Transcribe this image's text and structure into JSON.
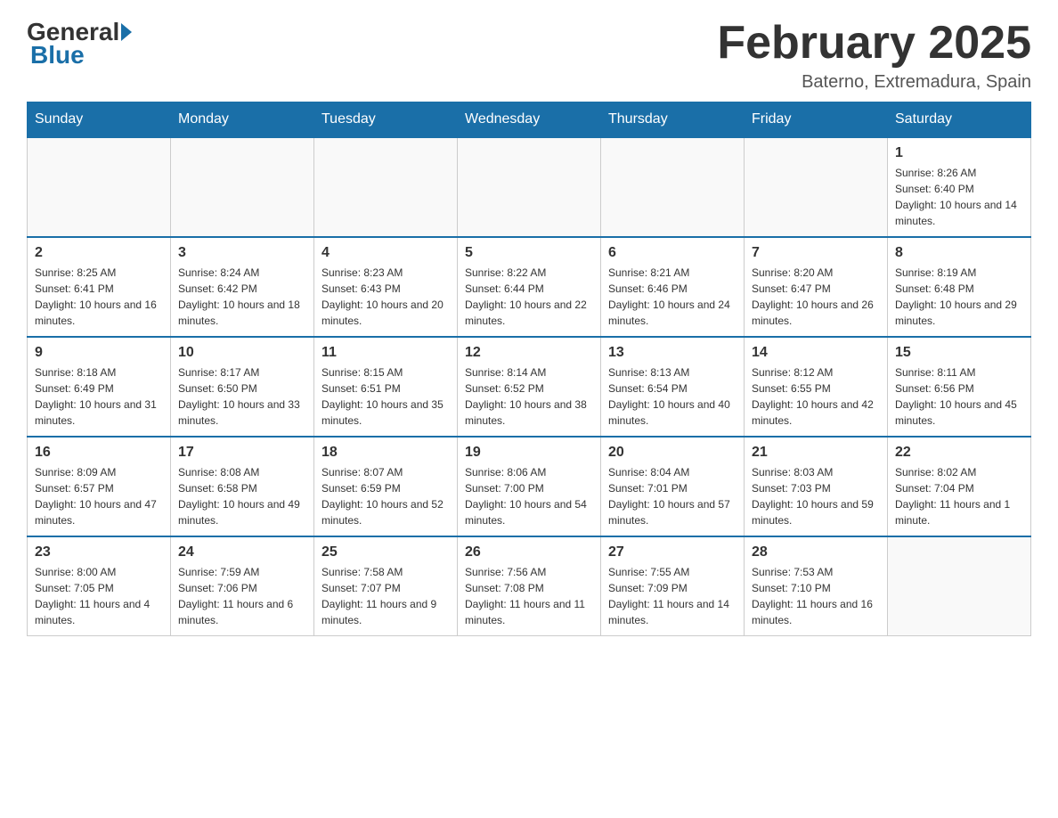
{
  "header": {
    "logo_general": "General",
    "logo_blue": "Blue",
    "month_title": "February 2025",
    "location": "Baterno, Extremadura, Spain"
  },
  "days_of_week": [
    "Sunday",
    "Monday",
    "Tuesday",
    "Wednesday",
    "Thursday",
    "Friday",
    "Saturday"
  ],
  "weeks": [
    {
      "days": [
        {
          "num": "",
          "info": ""
        },
        {
          "num": "",
          "info": ""
        },
        {
          "num": "",
          "info": ""
        },
        {
          "num": "",
          "info": ""
        },
        {
          "num": "",
          "info": ""
        },
        {
          "num": "",
          "info": ""
        },
        {
          "num": "1",
          "info": "Sunrise: 8:26 AM\nSunset: 6:40 PM\nDaylight: 10 hours and 14 minutes."
        }
      ]
    },
    {
      "days": [
        {
          "num": "2",
          "info": "Sunrise: 8:25 AM\nSunset: 6:41 PM\nDaylight: 10 hours and 16 minutes."
        },
        {
          "num": "3",
          "info": "Sunrise: 8:24 AM\nSunset: 6:42 PM\nDaylight: 10 hours and 18 minutes."
        },
        {
          "num": "4",
          "info": "Sunrise: 8:23 AM\nSunset: 6:43 PM\nDaylight: 10 hours and 20 minutes."
        },
        {
          "num": "5",
          "info": "Sunrise: 8:22 AM\nSunset: 6:44 PM\nDaylight: 10 hours and 22 minutes."
        },
        {
          "num": "6",
          "info": "Sunrise: 8:21 AM\nSunset: 6:46 PM\nDaylight: 10 hours and 24 minutes."
        },
        {
          "num": "7",
          "info": "Sunrise: 8:20 AM\nSunset: 6:47 PM\nDaylight: 10 hours and 26 minutes."
        },
        {
          "num": "8",
          "info": "Sunrise: 8:19 AM\nSunset: 6:48 PM\nDaylight: 10 hours and 29 minutes."
        }
      ]
    },
    {
      "days": [
        {
          "num": "9",
          "info": "Sunrise: 8:18 AM\nSunset: 6:49 PM\nDaylight: 10 hours and 31 minutes."
        },
        {
          "num": "10",
          "info": "Sunrise: 8:17 AM\nSunset: 6:50 PM\nDaylight: 10 hours and 33 minutes."
        },
        {
          "num": "11",
          "info": "Sunrise: 8:15 AM\nSunset: 6:51 PM\nDaylight: 10 hours and 35 minutes."
        },
        {
          "num": "12",
          "info": "Sunrise: 8:14 AM\nSunset: 6:52 PM\nDaylight: 10 hours and 38 minutes."
        },
        {
          "num": "13",
          "info": "Sunrise: 8:13 AM\nSunset: 6:54 PM\nDaylight: 10 hours and 40 minutes."
        },
        {
          "num": "14",
          "info": "Sunrise: 8:12 AM\nSunset: 6:55 PM\nDaylight: 10 hours and 42 minutes."
        },
        {
          "num": "15",
          "info": "Sunrise: 8:11 AM\nSunset: 6:56 PM\nDaylight: 10 hours and 45 minutes."
        }
      ]
    },
    {
      "days": [
        {
          "num": "16",
          "info": "Sunrise: 8:09 AM\nSunset: 6:57 PM\nDaylight: 10 hours and 47 minutes."
        },
        {
          "num": "17",
          "info": "Sunrise: 8:08 AM\nSunset: 6:58 PM\nDaylight: 10 hours and 49 minutes."
        },
        {
          "num": "18",
          "info": "Sunrise: 8:07 AM\nSunset: 6:59 PM\nDaylight: 10 hours and 52 minutes."
        },
        {
          "num": "19",
          "info": "Sunrise: 8:06 AM\nSunset: 7:00 PM\nDaylight: 10 hours and 54 minutes."
        },
        {
          "num": "20",
          "info": "Sunrise: 8:04 AM\nSunset: 7:01 PM\nDaylight: 10 hours and 57 minutes."
        },
        {
          "num": "21",
          "info": "Sunrise: 8:03 AM\nSunset: 7:03 PM\nDaylight: 10 hours and 59 minutes."
        },
        {
          "num": "22",
          "info": "Sunrise: 8:02 AM\nSunset: 7:04 PM\nDaylight: 11 hours and 1 minute."
        }
      ]
    },
    {
      "days": [
        {
          "num": "23",
          "info": "Sunrise: 8:00 AM\nSunset: 7:05 PM\nDaylight: 11 hours and 4 minutes."
        },
        {
          "num": "24",
          "info": "Sunrise: 7:59 AM\nSunset: 7:06 PM\nDaylight: 11 hours and 6 minutes."
        },
        {
          "num": "25",
          "info": "Sunrise: 7:58 AM\nSunset: 7:07 PM\nDaylight: 11 hours and 9 minutes."
        },
        {
          "num": "26",
          "info": "Sunrise: 7:56 AM\nSunset: 7:08 PM\nDaylight: 11 hours and 11 minutes."
        },
        {
          "num": "27",
          "info": "Sunrise: 7:55 AM\nSunset: 7:09 PM\nDaylight: 11 hours and 14 minutes."
        },
        {
          "num": "28",
          "info": "Sunrise: 7:53 AM\nSunset: 7:10 PM\nDaylight: 11 hours and 16 minutes."
        },
        {
          "num": "",
          "info": ""
        }
      ]
    }
  ]
}
